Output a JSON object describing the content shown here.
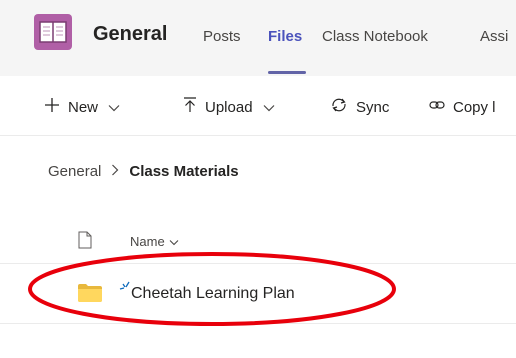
{
  "header": {
    "team_name": "General",
    "tabs": [
      {
        "label": "Posts",
        "active": false
      },
      {
        "label": "Files",
        "active": true
      },
      {
        "label": "Class Notebook",
        "active": false
      },
      {
        "label": "Assi",
        "active": false
      }
    ]
  },
  "toolbar": {
    "new_label": "New",
    "upload_label": "Upload",
    "sync_label": "Sync",
    "copy_label": "Copy l"
  },
  "breadcrumb": {
    "root": "General",
    "current": "Class Materials"
  },
  "file_list": {
    "name_column": "Name",
    "rows": [
      {
        "name": "Cheetah Learning Plan",
        "type": "folder",
        "is_new": true
      }
    ]
  },
  "colors": {
    "accent": "#6264a7",
    "active_tab": "#4b53bc",
    "folder": "#ffd75e",
    "annotation": "#e8000b",
    "team_logo": "#b05fa6"
  }
}
